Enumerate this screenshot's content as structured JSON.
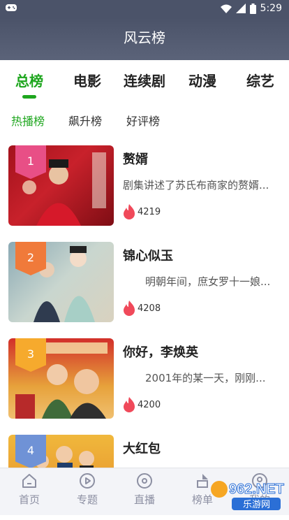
{
  "status": {
    "time": "5:29"
  },
  "header": {
    "title": "风云榜"
  },
  "categories": [
    "总榜",
    "电影",
    "连续剧",
    "动漫",
    "综艺"
  ],
  "subtabs": [
    "热播榜",
    "飙升榜",
    "好评榜"
  ],
  "items": [
    {
      "rank": "1",
      "title": "赘婿",
      "desc": "剧集讲述了苏氏布商家的赘婿...",
      "hot": "4219",
      "color": "#e84f86"
    },
    {
      "rank": "2",
      "title": "锦心似玉",
      "desc": "明朝年间，庶女罗十一娘...",
      "hot": "4208",
      "color": "#f07a3a"
    },
    {
      "rank": "3",
      "title": "你好，李焕英",
      "desc": "2001年的某一天，刚刚...",
      "hot": "4200",
      "color": "#f6aa2d"
    },
    {
      "rank": "4",
      "title": "大红包",
      "desc": "",
      "hot": "",
      "color": "#6f92d6"
    }
  ],
  "nav": [
    "首页",
    "专题",
    "直播",
    "榜单",
    "我的"
  ],
  "watermark": {
    "text": "962.NET",
    "sub": "乐游网"
  },
  "colors": {
    "accent": "#1ea61e",
    "header": "#4b5369"
  }
}
